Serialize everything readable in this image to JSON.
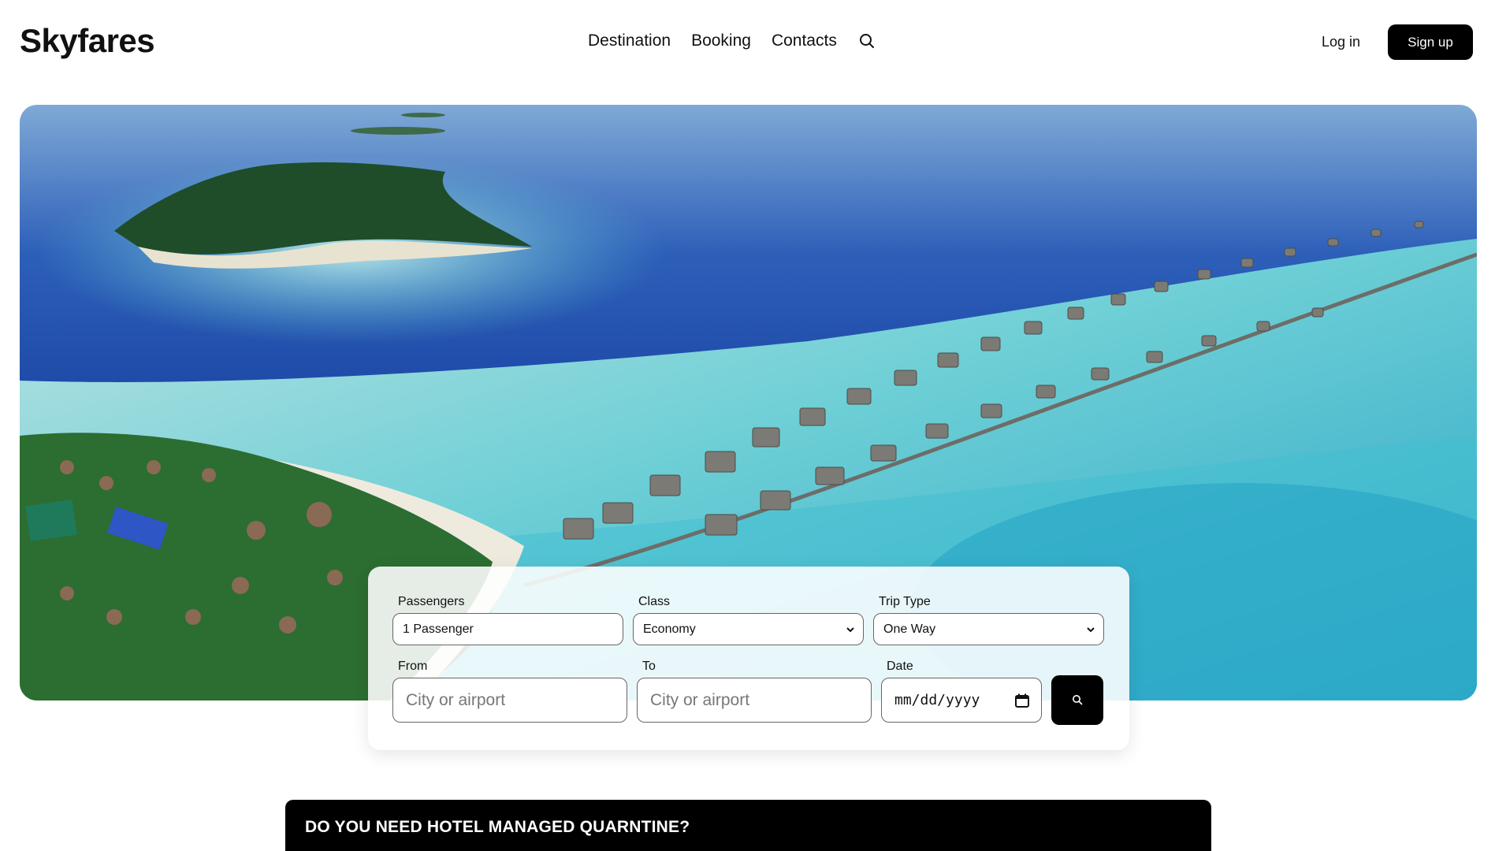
{
  "brand": {
    "name": "Skyfares"
  },
  "nav": {
    "items": [
      {
        "label": "Destination"
      },
      {
        "label": "Booking"
      },
      {
        "label": "Contacts"
      }
    ],
    "search_icon": "search-icon"
  },
  "auth": {
    "login_label": "Log in",
    "signup_label": "Sign up"
  },
  "hero": {
    "image": "aerial tropical island resort with overwater villas"
  },
  "search": {
    "passengers": {
      "label": "Passengers",
      "value": "1 Passenger"
    },
    "class": {
      "label": "Class",
      "value": "Economy"
    },
    "trip_type": {
      "label": "Trip Type",
      "value": "One Way"
    },
    "from": {
      "label": "From",
      "placeholder": "City or airport"
    },
    "to": {
      "label": "To",
      "placeholder": "City or airport"
    },
    "date": {
      "label": "Date",
      "placeholder": "mm/dd/yyyy"
    },
    "submit_icon": "search-icon"
  },
  "banner": {
    "text": "DO YOU  NEED HOTEL MANAGED QUARNTINE?"
  },
  "colors": {
    "primary": "#000000",
    "background": "#ffffff",
    "ocean_deep": "#1f4fb5",
    "ocean_shallow": "#3fc0cf"
  }
}
